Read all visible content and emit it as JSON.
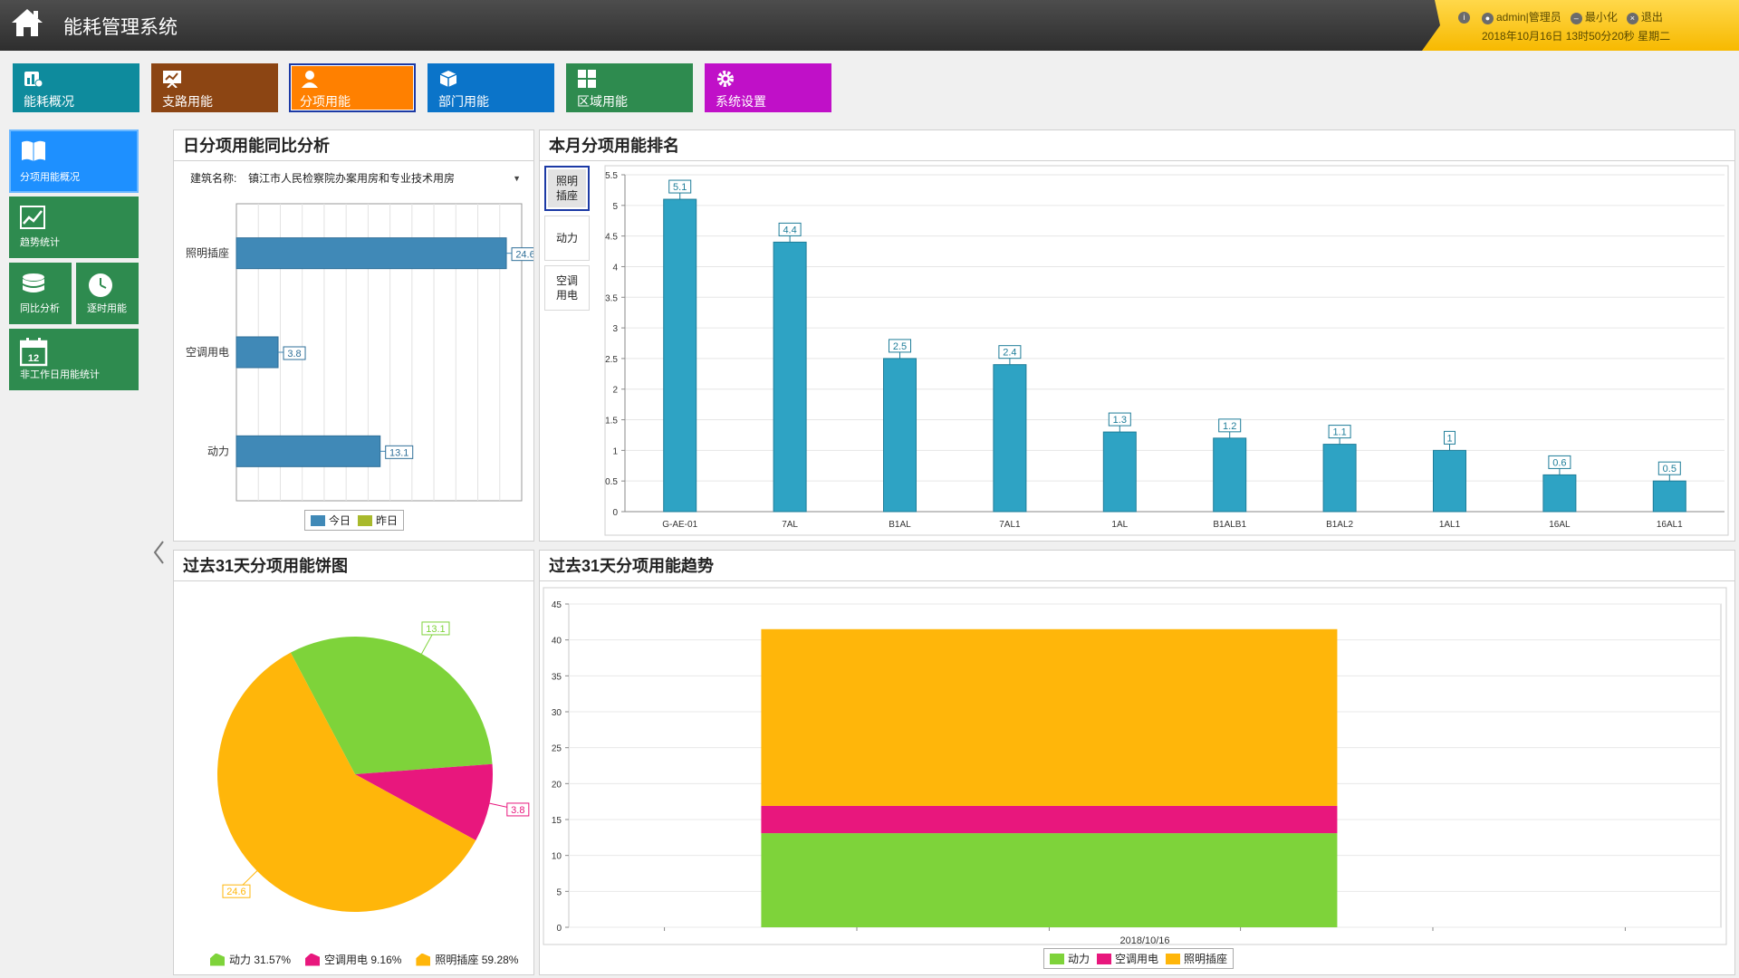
{
  "header": {
    "title": "能耗管理系统",
    "user": "admin|管理员",
    "minimize": "最小化",
    "logout": "退出",
    "datetime": "2018年10月16日 13时50分20秒 星期二"
  },
  "nav": {
    "tiles": [
      {
        "label": "能耗概况",
        "color": "#0e8b9d",
        "icon": "bar-chart-icon"
      },
      {
        "label": "支路用能",
        "color": "#8c4513",
        "icon": "presentation-icon"
      },
      {
        "label": "分项用能",
        "color": "#ff8000",
        "icon": "user-icon"
      },
      {
        "label": "部门用能",
        "color": "#0b74c9",
        "icon": "cube-icon"
      },
      {
        "label": "区域用能",
        "color": "#2e8b4f",
        "icon": "grid-icon"
      },
      {
        "label": "系统设置",
        "color": "#c010c8",
        "icon": "gear-icon"
      }
    ]
  },
  "sidebar": {
    "items": [
      {
        "label": "分项用能概况",
        "color": "#1e90ff",
        "icon": "book-icon"
      },
      {
        "label": "趋势统计",
        "color": "#2e8b4f",
        "icon": "trend-icon"
      },
      {
        "label": "同比分析",
        "color": "#2e8b4f",
        "icon": "database-icon"
      },
      {
        "label": "逐时用能",
        "color": "#2e8b4f",
        "icon": "clock-icon"
      },
      {
        "label": "非工作日用能统计",
        "color": "#2e8b4f",
        "icon": "calendar-icon",
        "day": "12"
      }
    ]
  },
  "daily_panel": {
    "title": "日分项用能同比分析",
    "building_label": "建筑名称:",
    "building_value": "镇江市人民检察院办案用房和专业技术用房",
    "legend": [
      {
        "name": "今日",
        "color": "#4089b7"
      },
      {
        "name": "昨日",
        "color": "#a8b92c"
      }
    ]
  },
  "ranking_panel": {
    "title": "本月分项用能排名",
    "tabs": [
      "照明\n插座",
      "动力",
      "空调\n用电"
    ]
  },
  "pie_panel": {
    "title": "过去31天分项用能饼图",
    "legend": [
      {
        "label": "动力 31.57%",
        "color": "#7ed33a"
      },
      {
        "label": "空调用电 9.16%",
        "color": "#e8177d"
      },
      {
        "label": "照明插座 59.28%",
        "color": "#ffb60a"
      }
    ]
  },
  "trend_panel": {
    "title": "过去31天分项用能趋势",
    "legend": [
      {
        "name": "动力",
        "color": "#7ed33a"
      },
      {
        "name": "空调用电",
        "color": "#e8177d"
      },
      {
        "name": "照明插座",
        "color": "#ffb60a"
      }
    ]
  },
  "chart_data": [
    {
      "id": "daily",
      "type": "bar",
      "orientation": "horizontal",
      "title": "日分项用能同比分析",
      "categories": [
        "照明插座",
        "空调用电",
        "动力"
      ],
      "series": [
        {
          "name": "今日",
          "values": [
            24.6,
            3.8,
            13.1
          ],
          "color": "#4089b7"
        },
        {
          "name": "昨日",
          "values": [
            0,
            0,
            0
          ],
          "color": "#a8b92c"
        }
      ],
      "xlim": [
        0,
        26
      ],
      "legend": "bottom"
    },
    {
      "id": "ranking",
      "type": "bar",
      "title": "本月分项用能排名",
      "categories": [
        "G-AE-01",
        "7AL",
        "B1AL",
        "7AL1",
        "1AL",
        "B1ALB1",
        "B1AL2",
        "1AL1",
        "16AL",
        "16AL1"
      ],
      "values": [
        5.1,
        4.4,
        2.5,
        2.4,
        1.3,
        1.2,
        1.1,
        1,
        0.6,
        0.5
      ],
      "ylim": [
        0,
        5.5
      ],
      "yticks": [
        "0",
        "0.5",
        "1",
        "1.5",
        "2",
        "2.5",
        "3",
        "3.5",
        "4",
        "4.5",
        "5",
        "5.5"
      ],
      "color": "#2ea3c4",
      "grid": true
    },
    {
      "id": "pie",
      "type": "pie",
      "title": "过去31天分项用能饼图",
      "slices": [
        {
          "name": "动力",
          "value": 13.1,
          "label": "13.1",
          "percent": "31.57%",
          "color": "#7ed33a"
        },
        {
          "name": "空调用电",
          "value": 3.8,
          "label": "3.8",
          "percent": "9.16%",
          "color": "#e8177d"
        },
        {
          "name": "照明插座",
          "value": 24.6,
          "label": "24.6",
          "percent": "59.28%",
          "color": "#ffb60a"
        }
      ],
      "legend": "bottom"
    },
    {
      "id": "trend",
      "type": "bar",
      "stacked": true,
      "title": "过去31天分项用能趋势",
      "categories": [
        "2018/10/16"
      ],
      "series": [
        {
          "name": "动力",
          "values": [
            13.1
          ],
          "color": "#7ed33a"
        },
        {
          "name": "空调用电",
          "values": [
            3.8
          ],
          "color": "#e8177d"
        },
        {
          "name": "照明插座",
          "values": [
            24.6
          ],
          "color": "#ffb60a"
        }
      ],
      "ylim": [
        0,
        45
      ],
      "yticks": [
        "0",
        "5",
        "10",
        "15",
        "20",
        "25",
        "30",
        "35",
        "40",
        "45"
      ],
      "grid": true,
      "legend": "bottom"
    }
  ]
}
